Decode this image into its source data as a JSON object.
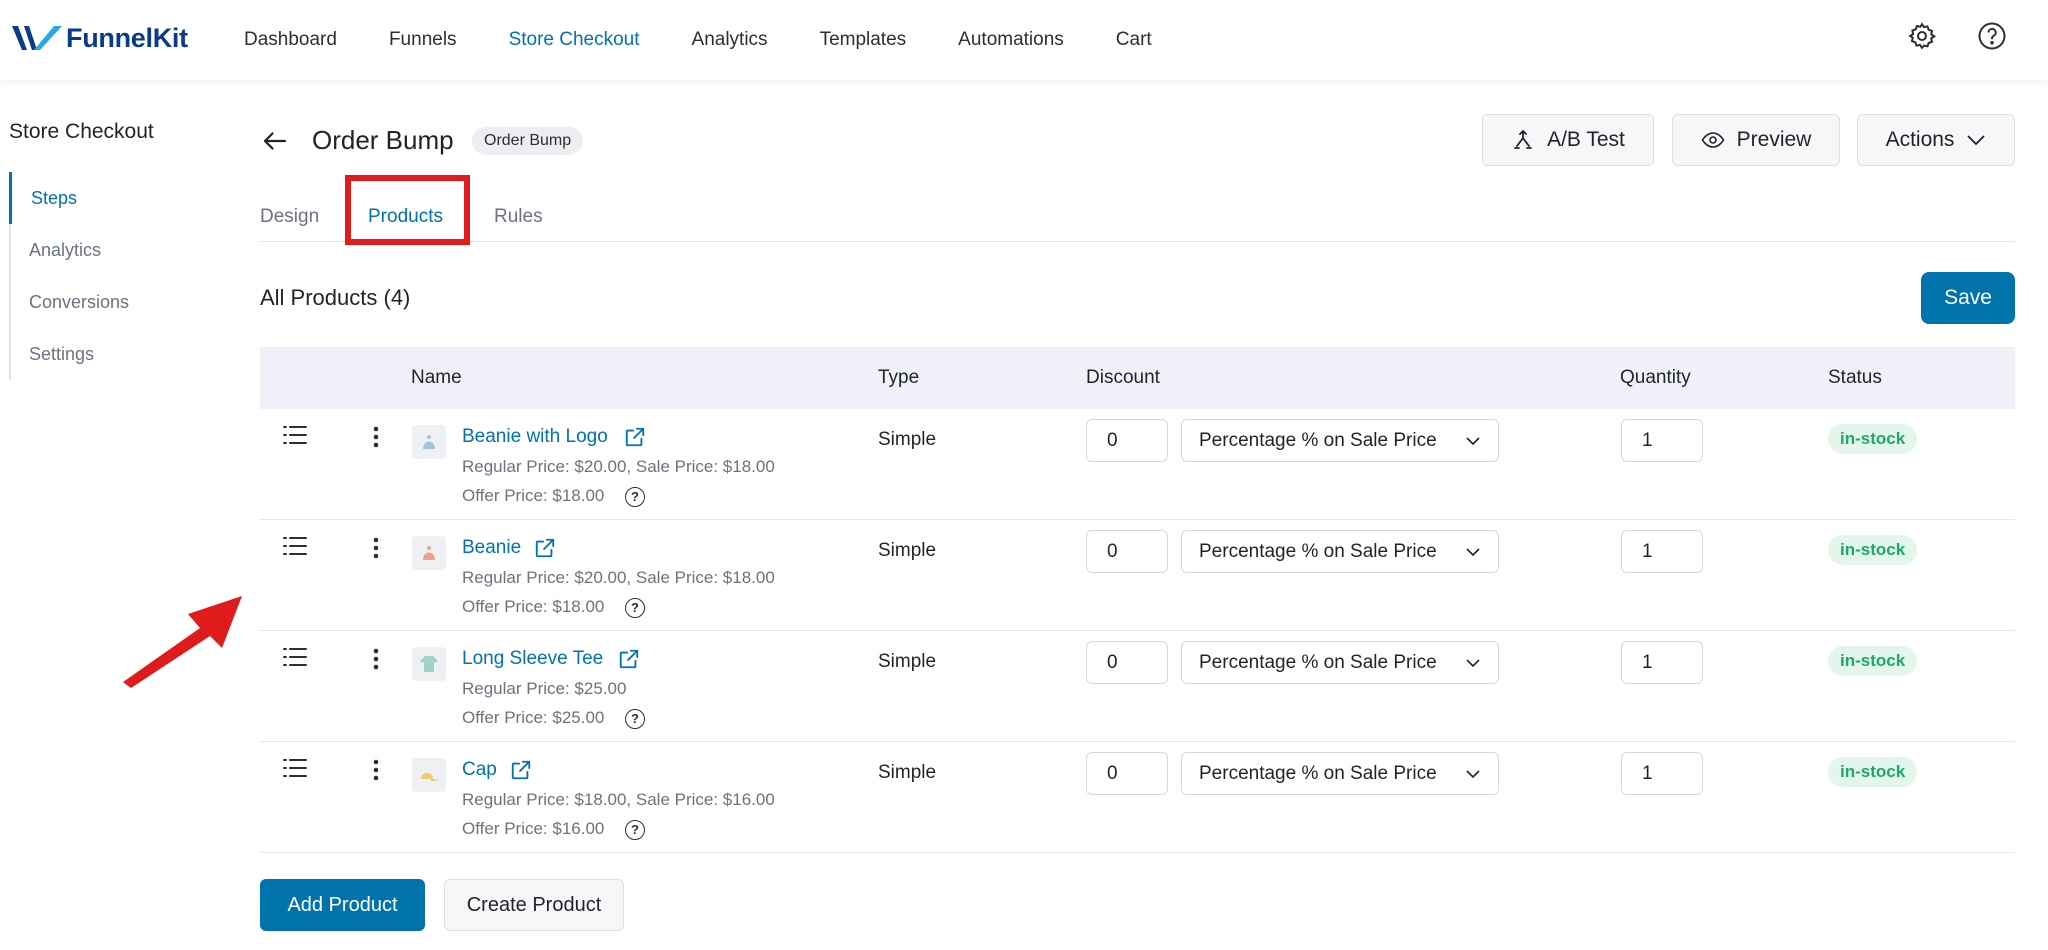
{
  "brand": {
    "name": "FunnelKit",
    "primary_color": "#0073aa",
    "logo_color": "#0a3a8c"
  },
  "nav": {
    "items": [
      {
        "label": "Dashboard",
        "active": false
      },
      {
        "label": "Funnels",
        "active": false
      },
      {
        "label": "Store Checkout",
        "active": true
      },
      {
        "label": "Analytics",
        "active": false
      },
      {
        "label": "Templates",
        "active": false
      },
      {
        "label": "Automations",
        "active": false
      },
      {
        "label": "Cart",
        "active": false
      }
    ],
    "icons": [
      "gear-icon",
      "help-circle-icon"
    ]
  },
  "sidebar": {
    "title": "Store Checkout",
    "items": [
      {
        "label": "Steps",
        "active": true
      },
      {
        "label": "Analytics",
        "active": false
      },
      {
        "label": "Conversions",
        "active": false
      },
      {
        "label": "Settings",
        "active": false
      }
    ]
  },
  "header": {
    "title": "Order Bump",
    "badge": "Order Bump",
    "ab_test_label": "A/B Test",
    "preview_label": "Preview",
    "actions_label": "Actions"
  },
  "tabs": [
    {
      "label": "Design",
      "active": false
    },
    {
      "label": "Products",
      "active": true
    },
    {
      "label": "Rules",
      "active": false
    }
  ],
  "products": {
    "heading": "All Products (4)",
    "save_label": "Save",
    "columns": {
      "name": "Name",
      "type": "Type",
      "discount": "Discount",
      "quantity": "Quantity",
      "status": "Status"
    },
    "rows": [
      {
        "name": "Beanie with Logo",
        "thumb_color": "#9fc6d6",
        "price": "Regular Price: $20.00, Sale Price: $18.00",
        "offer": "Offer Price: $18.00",
        "type": "Simple",
        "discount": "0",
        "discount_type": "Percentage % on Sale Price",
        "quantity": "1",
        "status": "in-stock"
      },
      {
        "name": "Beanie",
        "thumb_color": "#f0a08a",
        "price": "Regular Price: $20.00, Sale Price: $18.00",
        "offer": "Offer Price: $18.00",
        "type": "Simple",
        "discount": "0",
        "discount_type": "Percentage % on Sale Price",
        "quantity": "1",
        "status": "in-stock"
      },
      {
        "name": "Long Sleeve Tee",
        "thumb_color": "#9fd3c7",
        "price": "Regular Price: $25.00",
        "offer": "Offer Price: $25.00",
        "type": "Simple",
        "discount": "0",
        "discount_type": "Percentage % on Sale Price",
        "quantity": "1",
        "status": "in-stock"
      },
      {
        "name": "Cap",
        "thumb_color": "#f2c96b",
        "price": "Regular Price: $18.00, Sale Price: $16.00",
        "offer": "Offer Price: $16.00",
        "type": "Simple",
        "discount": "0",
        "discount_type": "Percentage % on Sale Price",
        "quantity": "1",
        "status": "in-stock"
      }
    ],
    "add_label": "Add Product",
    "create_label": "Create Product"
  },
  "annotations": {
    "highlight_color": "#e01b1b"
  }
}
